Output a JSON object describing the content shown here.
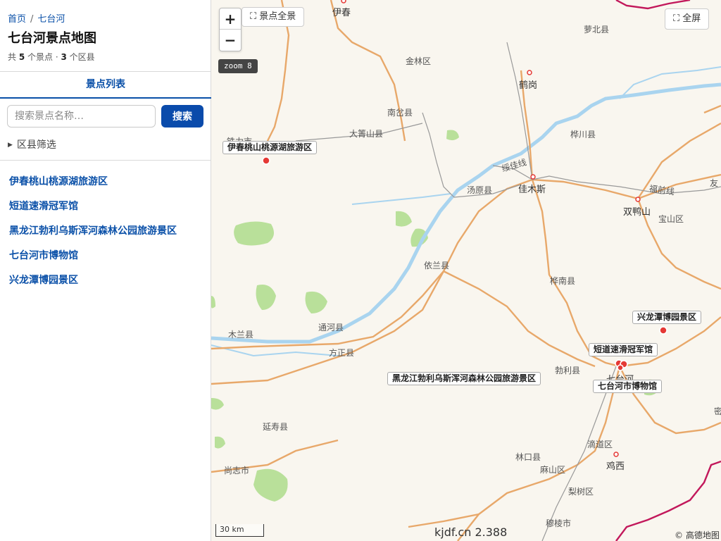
{
  "breadcrumb": {
    "home": "首页",
    "sep": "/",
    "current": "七台河"
  },
  "page_title": "七台河景点地图",
  "summary": {
    "prefix": "共 ",
    "spots": "5",
    "mid": " 个景点 · ",
    "districts": "3",
    "suffix": " 个区县"
  },
  "tab": {
    "label": "景点列表"
  },
  "search": {
    "placeholder": "搜索景点名称…",
    "button": "搜索"
  },
  "filter": {
    "label": "区县筛选",
    "icon": "triangle-right-icon"
  },
  "poi_list": [
    "伊春桃山桃源湖旅游区",
    "短道速滑冠军馆",
    "黑龙江勃利乌斯浑河森林公园旅游景区",
    "七台河市博物馆",
    "兴龙潭博园景区"
  ],
  "map": {
    "zoom_in": "+",
    "zoom_out": "−",
    "fit_all": "景点全景",
    "fit_icon": "expand-icon",
    "fullscreen": "全屏",
    "zoom_badge": "zoom 8",
    "scale": "30 km",
    "attribution": "© 高德地图",
    "version": "kjdf.cn 2.388",
    "places": {
      "yichun": "伊春",
      "luobei": "萝北县",
      "jinlin": "金林区",
      "hegang": "鹤岗",
      "nancha": "南岔县",
      "dajingshan": "大箐山县",
      "tieli": "铁力市",
      "huachuan": "桦川县",
      "suijia": "绥佳线",
      "jiamusi": "佳木斯",
      "tangyuan": "汤原县",
      "fuqian": "福前线",
      "you": "友",
      "shuangyashan": "双鸭山",
      "baoshan": "宝山区",
      "yilan": "依兰县",
      "huanan": "桦南县",
      "mulan": "木兰县",
      "tonghe": "通河县",
      "fangzheng": "方正县",
      "boli": "勃利县",
      "qitaihe": "七台河",
      "yanshou": "延寿县",
      "didao": "滴道区",
      "jixi": "鸡西",
      "linkou": "林口县",
      "mashan": "麻山区",
      "shangzhi": "尚志市",
      "lishu": "梨树区",
      "muling": "穆棱市",
      "mi": "密"
    },
    "poi_labels": {
      "taoyuanhu": "伊春桃山桃源湖旅游区",
      "xinglongtan": "兴龙潭博园景区",
      "duandao": "短道速滑冠军馆",
      "wusihun": "黑龙江勃利乌斯浑河森林公园旅游景区",
      "museum": "七台河市博物馆"
    }
  },
  "colors": {
    "accent": "#0a4bab",
    "link": "#0a50a8",
    "map_bg": "#f9f6ef",
    "road": "#e8a86a",
    "river": "#a9d4ef",
    "forest": "#b9e09a",
    "poi_marker": "#e53935",
    "border": "#c2185b"
  }
}
